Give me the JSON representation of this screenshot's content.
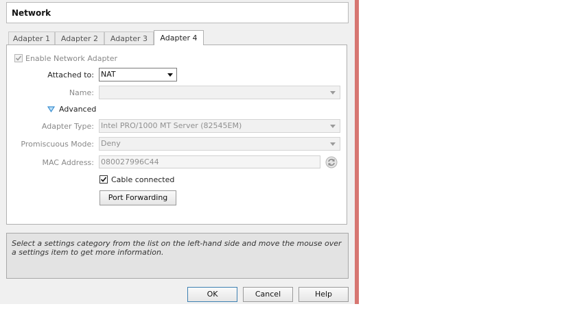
{
  "header": {
    "title": "Network"
  },
  "tabs": [
    {
      "label": "Adapter 1"
    },
    {
      "label": "Adapter 2"
    },
    {
      "label": "Adapter 3"
    },
    {
      "label": "Adapter 4",
      "active": true
    }
  ],
  "adapter": {
    "enable_label": "Enable Network Adapter",
    "enabled": true,
    "attached_to_label": "Attached to:",
    "attached_to_value": "NAT",
    "name_label": "Name:",
    "name_value": "",
    "advanced_label": "Advanced",
    "adapter_type_label": "Adapter Type:",
    "adapter_type_value": "Intel PRO/1000 MT Server (82545EM)",
    "promiscuous_label": "Promiscuous Mode:",
    "promiscuous_value": "Deny",
    "mac_label": "MAC Address:",
    "mac_value": "080027996C44",
    "cable_label": "Cable connected",
    "cable_connected": true,
    "port_forwarding_label": "Port Forwarding"
  },
  "info": {
    "text": "Select a settings category from the list on the left-hand side and move the mouse over a settings item to get more information."
  },
  "buttons": {
    "ok": "OK",
    "cancel": "Cancel",
    "help": "Help"
  },
  "colors": {
    "right_border": "#d77772",
    "accent_arrow": "#3a8fd1"
  },
  "icons": {
    "refresh": "refresh-icon",
    "expand": "triangle-down-icon"
  }
}
